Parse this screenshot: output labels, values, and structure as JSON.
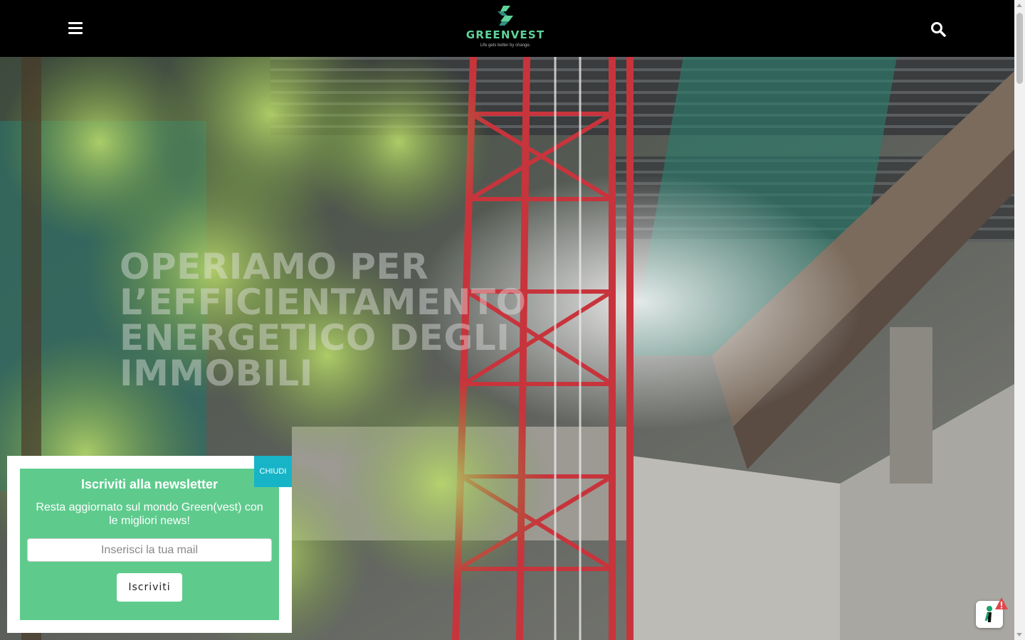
{
  "header": {
    "logo_name": "GREENVEST",
    "logo_tagline": "Life gets better by change.",
    "menu_icon": "hamburger-menu-icon",
    "search_icon": "search-icon"
  },
  "hero": {
    "title": "OPERIAMO PER L’EFFICIENTAMENTO ENERGETICO DEGLI IMMOBILI"
  },
  "newsletter": {
    "title": "Iscriviti alla newsletter",
    "text": "Resta aggiornato sul mondo Green(vest) con le migliori news!",
    "input_placeholder": "Inserisci la tua mail",
    "button_label": "Iscriviti",
    "close_label": "CHIUDI"
  },
  "widget": {
    "icon": "accessibility-icon",
    "badge_icon": "alert-badge-icon"
  },
  "colors": {
    "brand_green": "#5fd39a",
    "popup_green": "#5ecb8d",
    "close_teal": "#17b4c7",
    "header_bg": "#000000"
  }
}
